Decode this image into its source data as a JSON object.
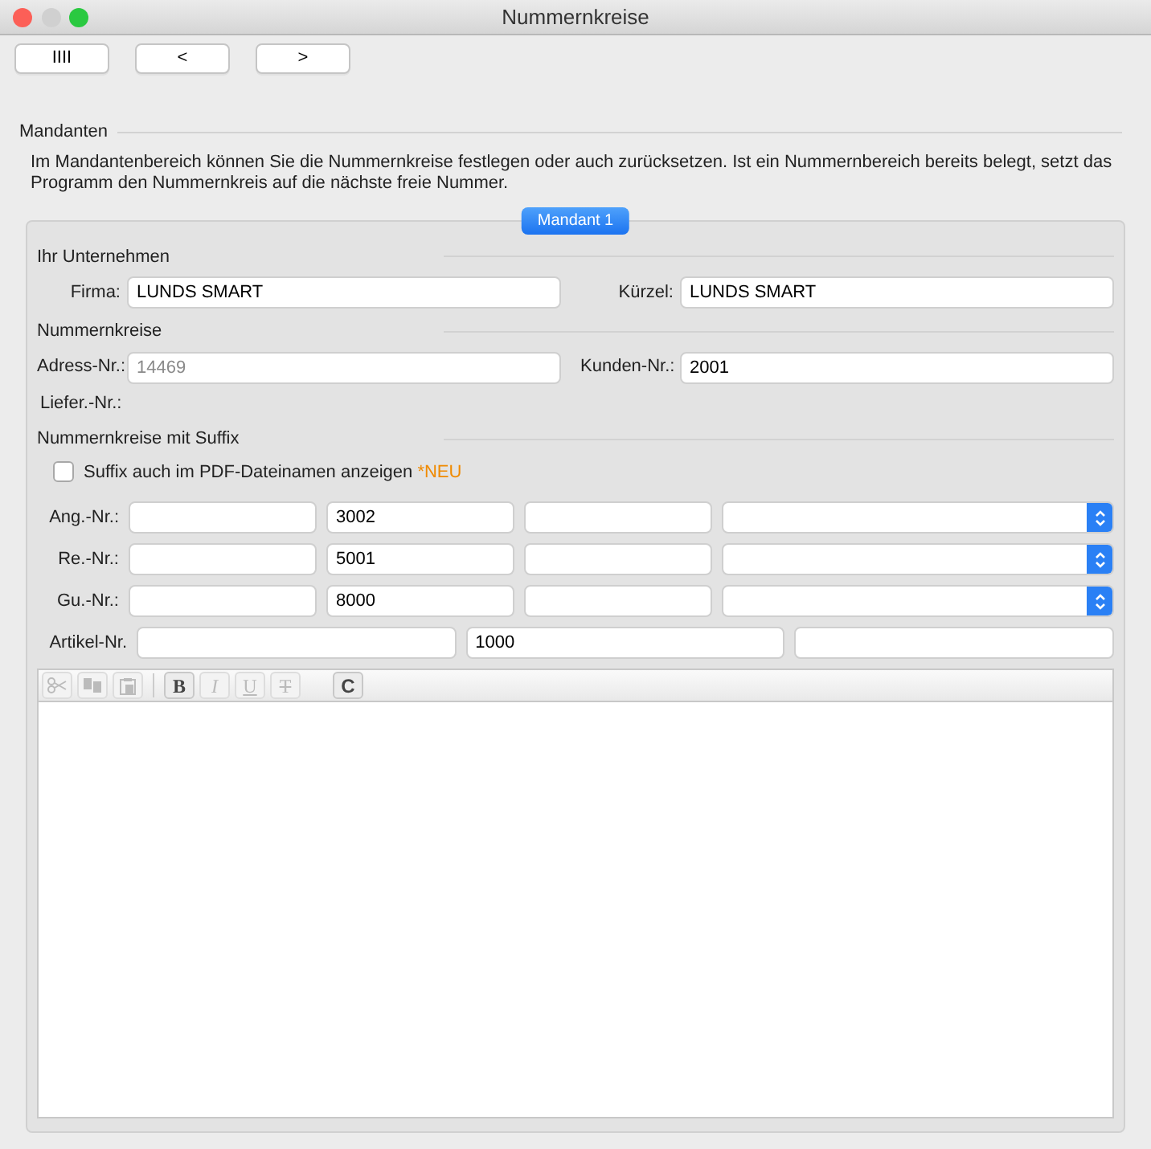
{
  "window": {
    "title": "Nummernkreise"
  },
  "toolbar": [
    {
      "label": "IIII"
    },
    {
      "label": "<"
    },
    {
      "label": ">"
    }
  ],
  "group": {
    "title": "Mandanten",
    "description": "Im Mandantenbereich können Sie die Nummernkreise festlegen oder auch zurücksetzen. Ist ein Nummernbereich bereits belegt, setzt das Programm den Nummernkreis auf die nächste freie Nummer."
  },
  "tabs": [
    {
      "label": "Mandant 1",
      "selected": true
    }
  ],
  "company": {
    "title": "Ihr Unternehmen",
    "fields": [
      {
        "label": "Firma:",
        "value": "LUNDS SMART"
      },
      {
        "label": "Kürzel:",
        "value": "LUNDS SMART"
      }
    ]
  },
  "numbers": {
    "title": "Nummernkreise",
    "fields": [
      {
        "label": "Adress-Nr.:",
        "placeholder": "14469"
      },
      {
        "label": "Kunden-Nr.:",
        "value": "2001"
      }
    ],
    "extra_label": "Liefer.-Nr.:"
  },
  "suffix": {
    "title": "Nummernkreise mit Suffix",
    "checkbox": {
      "label": "Suffix auch im PDF-Dateinamen anzeigen",
      "badge": "*NEU",
      "checked": false
    },
    "rows": [
      {
        "label": "Ang.-Nr.:",
        "fields": [
          {
            "kind": "input"
          },
          {
            "kind": "input",
            "value": "3002"
          },
          {
            "kind": "input"
          },
          {
            "kind": "select"
          }
        ]
      },
      {
        "label": "Re.-Nr.:",
        "fields": [
          {
            "kind": "input"
          },
          {
            "kind": "input",
            "value": "5001"
          },
          {
            "kind": "input"
          },
          {
            "kind": "select"
          }
        ]
      },
      {
        "label": "Gu.-Nr.:",
        "fields": [
          {
            "kind": "input"
          },
          {
            "kind": "input",
            "value": "8000"
          },
          {
            "kind": "input"
          },
          {
            "kind": "select"
          }
        ]
      },
      {
        "label": "Artikel-Nr.",
        "fields": [
          {
            "kind": "input"
          },
          {
            "kind": "input",
            "value": "1000"
          },
          {
            "kind": "input"
          }
        ]
      }
    ]
  },
  "editor": {
    "toolbar": [
      {
        "kind": "cut",
        "disabled": true
      },
      {
        "kind": "copy",
        "disabled": true
      },
      {
        "kind": "paste",
        "disabled": true
      },
      {
        "kind": "sep"
      },
      {
        "kind": "bold",
        "label": "B",
        "disabled": false
      },
      {
        "kind": "italic",
        "label": "I",
        "disabled": true
      },
      {
        "kind": "underline",
        "label": "U",
        "disabled": true
      },
      {
        "kind": "strike",
        "label": "T",
        "disabled": true
      },
      {
        "kind": "gap"
      },
      {
        "kind": "plain",
        "label": "C",
        "disabled": false
      }
    ]
  }
}
